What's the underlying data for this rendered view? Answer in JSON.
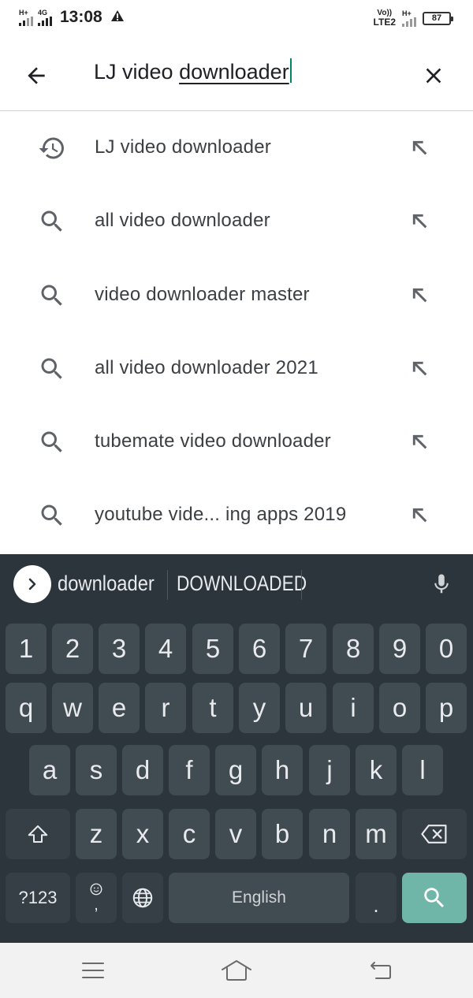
{
  "status_bar": {
    "sim1": "H+",
    "sim2": "4G",
    "time": "13:08",
    "volte": "Vo))",
    "lte": "LTE2",
    "sim3": "H+",
    "battery": "87"
  },
  "search": {
    "query_plain": "LJ video ",
    "query_underlined": "downloader"
  },
  "suggestions": [
    {
      "icon": "history-icon",
      "text": "LJ video downloader"
    },
    {
      "icon": "search-icon",
      "text": "all video downloader"
    },
    {
      "icon": "search-icon",
      "text": "video downloader master"
    },
    {
      "icon": "search-icon",
      "text": "all video downloader 2021"
    },
    {
      "icon": "search-icon",
      "text": "tubemate video downloader"
    },
    {
      "icon": "search-icon",
      "text": "youtube vide... ing apps 2019"
    }
  ],
  "keyboard": {
    "suggestion_1": "downloader",
    "suggestion_2": "DOWNLOADED",
    "row_numbers": [
      "1",
      "2",
      "3",
      "4",
      "5",
      "6",
      "7",
      "8",
      "9",
      "0"
    ],
    "row_1": [
      "q",
      "w",
      "e",
      "r",
      "t",
      "y",
      "u",
      "i",
      "o",
      "p"
    ],
    "row_2": [
      "a",
      "s",
      "d",
      "f",
      "g",
      "h",
      "j",
      "k",
      "l"
    ],
    "row_3": [
      "z",
      "x",
      "c",
      "v",
      "b",
      "n",
      "m"
    ],
    "symbols_label": "?123",
    "emoji_comma": ",",
    "space_label": "English",
    "period": "."
  },
  "colors": {
    "accent": "#01875f",
    "keyboard_bg": "#2c353b",
    "key_bg": "#414c52",
    "action_key": "#6fb5a8"
  }
}
